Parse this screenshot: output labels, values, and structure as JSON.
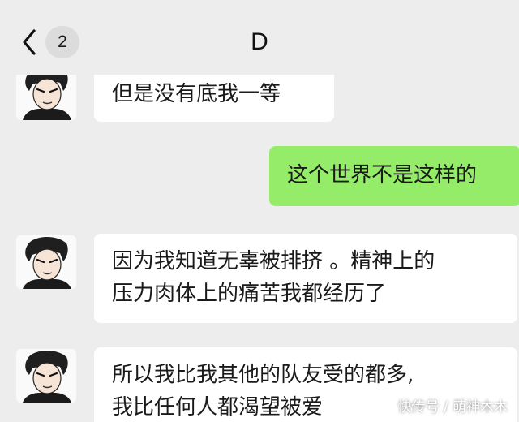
{
  "header": {
    "back_icon": "chevron-left-icon",
    "unread_count": "2",
    "title": "D"
  },
  "messages": [
    {
      "sender": "contact",
      "text": "但是没有底我一等"
    },
    {
      "sender": "me",
      "text": "这个世界不是这样的"
    },
    {
      "sender": "contact",
      "lines": [
        "因为我知道无辜被排挤 。精神上的",
        "压力肉体上的痛苦我都经历了"
      ]
    },
    {
      "sender": "contact",
      "lines": [
        "所以我比我其他的队友受的都多,",
        "我比任何人都渴望被爱"
      ]
    }
  ],
  "watermark": "快传号 / 萌神木木",
  "colors": {
    "background": "#ededed",
    "sent_bubble": "#95ec69",
    "received_bubble": "#ffffff"
  }
}
